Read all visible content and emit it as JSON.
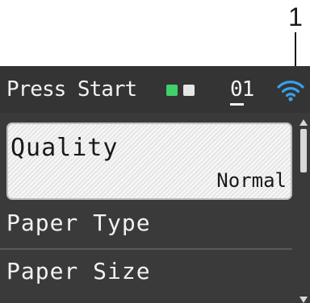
{
  "callout": {
    "number": "1"
  },
  "status_bar": {
    "title": "Press Start",
    "copies": "01",
    "indicator_colors": [
      "#3fd16a",
      "#e6e6e6"
    ],
    "wifi_icon": "wifi-icon",
    "wifi_color": "#3aa0e8"
  },
  "menu": {
    "items": [
      {
        "label": "Quality",
        "value": "Normal",
        "selected": true
      },
      {
        "label": "Paper Type"
      },
      {
        "label": "Paper Size"
      }
    ]
  }
}
